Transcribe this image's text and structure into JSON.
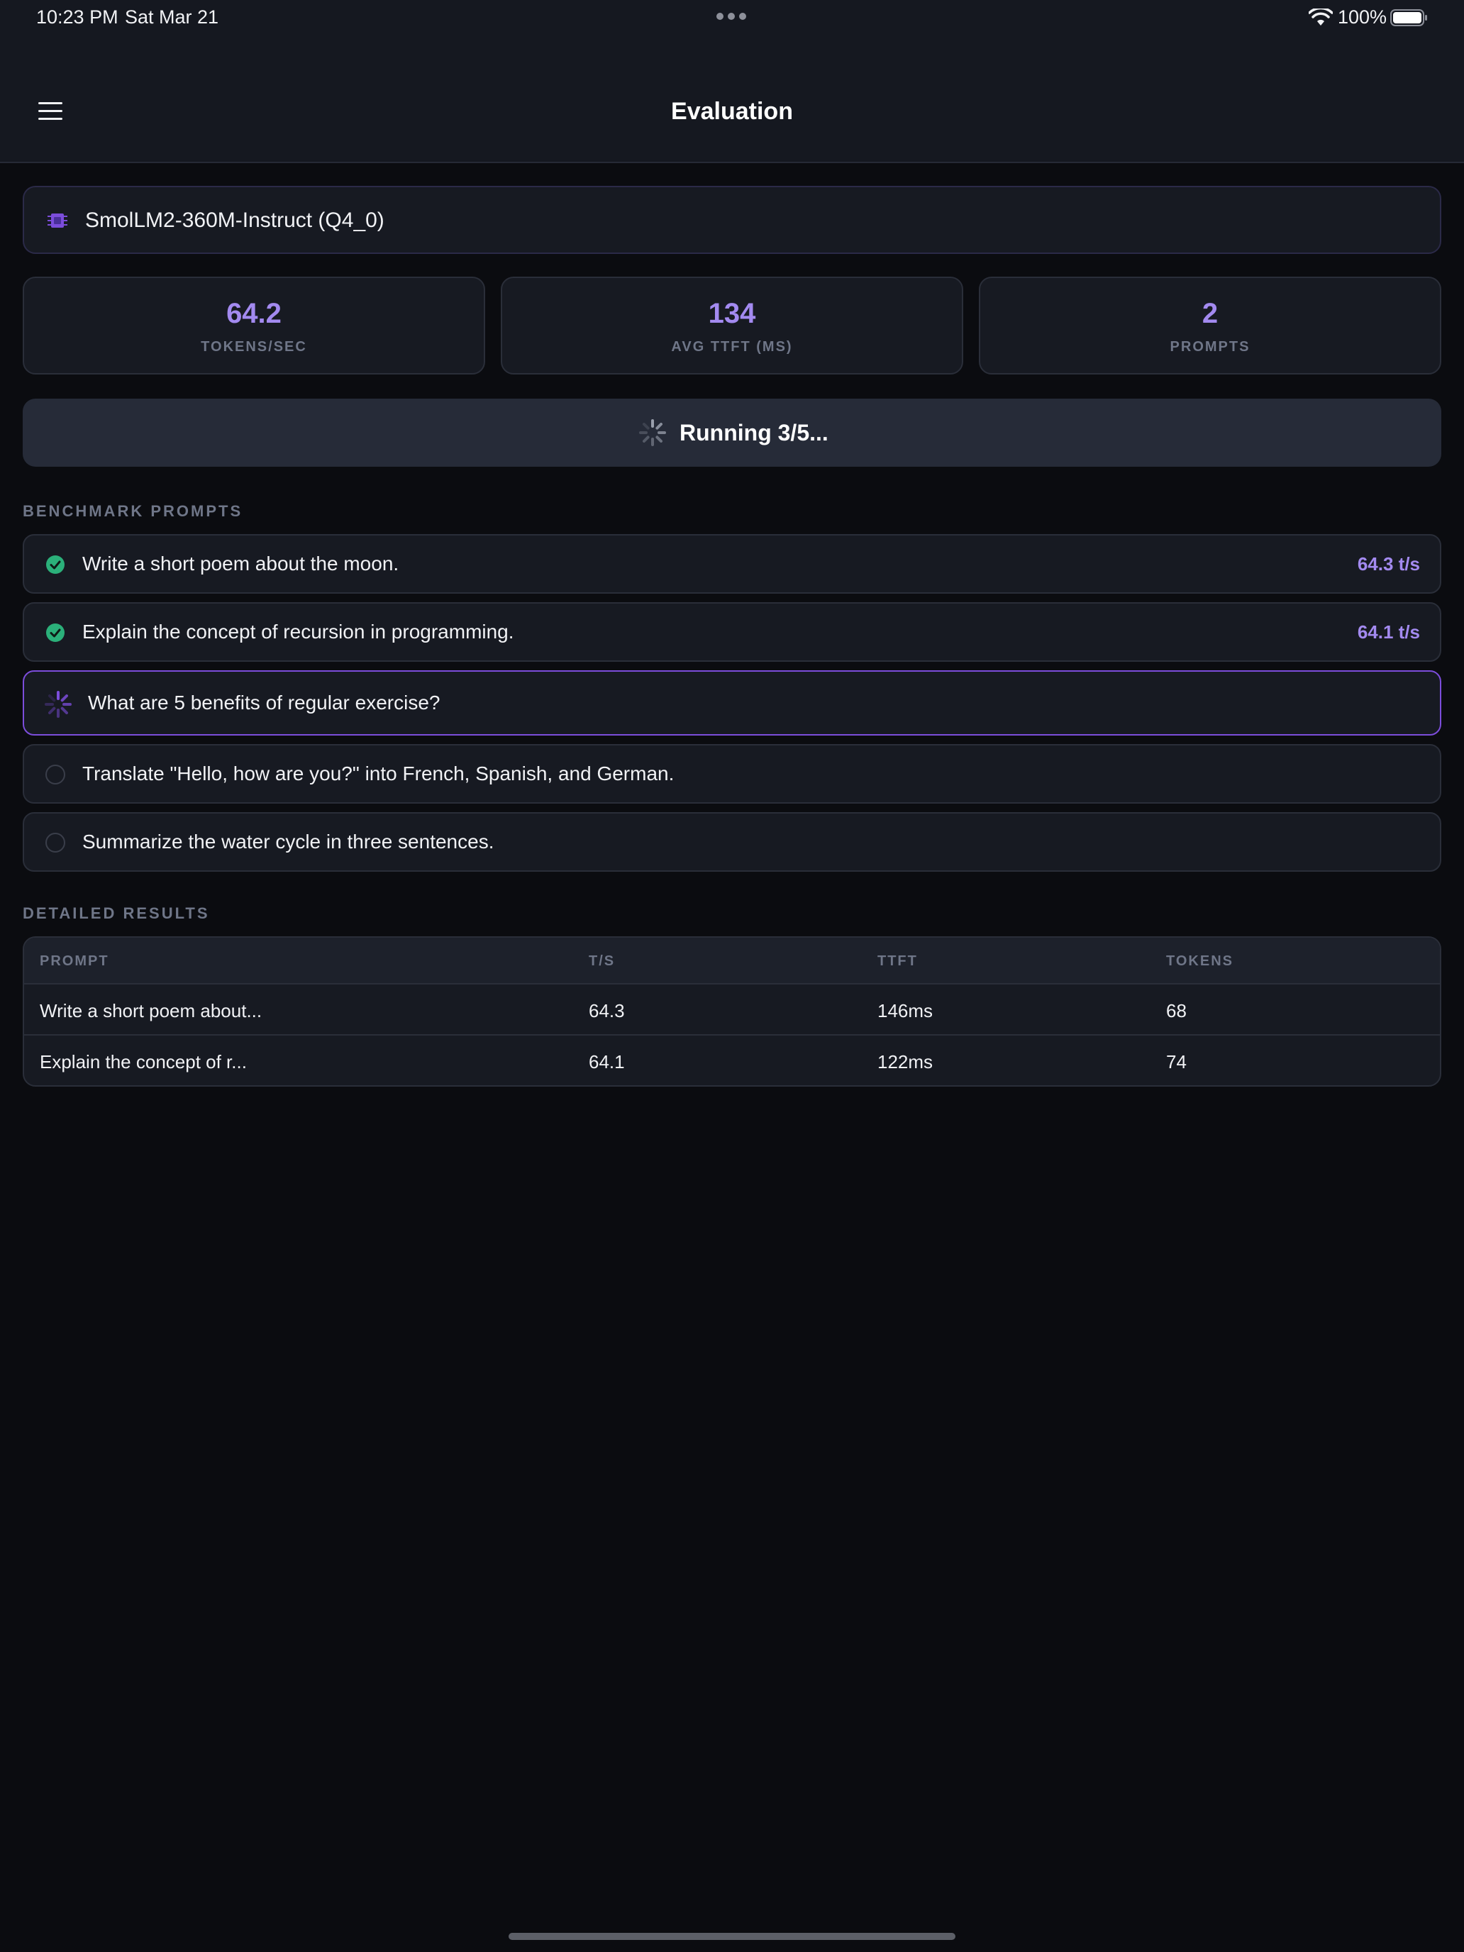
{
  "status_bar": {
    "time": "10:23 PM",
    "date": "Sat Mar 21",
    "battery": "100%"
  },
  "header": {
    "title": "Evaluation"
  },
  "model": {
    "name": "SmolLM2-360M-Instruct (Q4_0)"
  },
  "stats": [
    {
      "value": "64.2",
      "label": "TOKENS/SEC"
    },
    {
      "value": "134",
      "label": "AVG TTFT (MS)"
    },
    {
      "value": "2",
      "label": "PROMPTS"
    }
  ],
  "run_button": {
    "label": "Running 3/5..."
  },
  "benchmark": {
    "heading": "BENCHMARK PROMPTS",
    "prompts": [
      {
        "text": "Write a short poem about the moon.",
        "status": "done",
        "rate": "64.3 t/s"
      },
      {
        "text": "Explain the concept of recursion in programming.",
        "status": "done",
        "rate": "64.1 t/s"
      },
      {
        "text": "What are 5 benefits of regular exercise?",
        "status": "running",
        "rate": ""
      },
      {
        "text": "Translate \"Hello, how are you?\" into French, Spanish, and German.",
        "status": "pending",
        "rate": ""
      },
      {
        "text": "Summarize the water cycle in three sentences.",
        "status": "pending",
        "rate": ""
      }
    ]
  },
  "results": {
    "heading": "DETAILED RESULTS",
    "columns": [
      "PROMPT",
      "T/S",
      "TTFT",
      "TOKENS"
    ],
    "rows": [
      [
        "Write a short poem about...",
        "64.3",
        "146ms",
        "68"
      ],
      [
        "Explain the concept of r...",
        "64.1",
        "122ms",
        "74"
      ]
    ]
  },
  "colors": {
    "accent": "#a38af0",
    "success": "#2bb07a",
    "active_border": "#7c4ddb",
    "background": "#0b0c10"
  }
}
